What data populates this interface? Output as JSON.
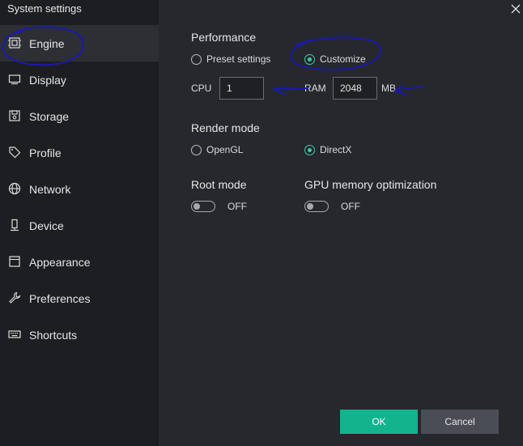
{
  "window": {
    "title": "System settings"
  },
  "sidebar": {
    "items": [
      {
        "label": "Engine",
        "icon": "chip-icon",
        "active": true
      },
      {
        "label": "Display",
        "icon": "monitor-icon"
      },
      {
        "label": "Storage",
        "icon": "disk-icon"
      },
      {
        "label": "Profile",
        "icon": "tag-icon"
      },
      {
        "label": "Network",
        "icon": "globe-icon"
      },
      {
        "label": "Device",
        "icon": "phone-icon"
      },
      {
        "label": "Appearance",
        "icon": "window-icon"
      },
      {
        "label": "Preferences",
        "icon": "wrench-icon"
      },
      {
        "label": "Shortcuts",
        "icon": "keyboard-icon"
      }
    ]
  },
  "performance": {
    "title": "Performance",
    "preset_label": "Preset settings",
    "customize_label": "Customize",
    "selected": "Customize",
    "cpu_label": "CPU",
    "cpu_value": "1",
    "ram_label": "RAM",
    "ram_value": "2048",
    "ram_unit": "MB"
  },
  "render": {
    "title": "Render mode",
    "opengl_label": "OpenGL",
    "directx_label": "DirectX",
    "selected": "DirectX"
  },
  "root": {
    "title": "Root mode",
    "state": "OFF"
  },
  "gpu": {
    "title": "GPU memory optimization",
    "state": "OFF"
  },
  "buttons": {
    "ok": "OK",
    "cancel": "Cancel"
  },
  "colors": {
    "accent": "#13b38d",
    "radio_checked": "#3fc9a8",
    "annotation": "#1a1aaa"
  }
}
